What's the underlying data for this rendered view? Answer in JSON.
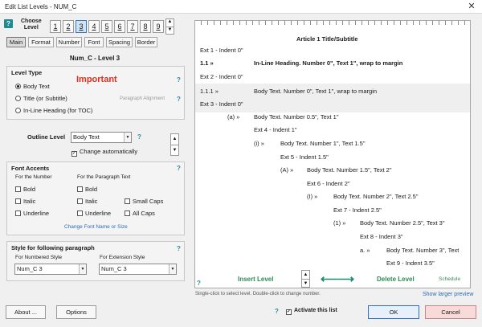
{
  "window": {
    "title": "Edit List Levels - NUM_C",
    "close": "✕"
  },
  "help": "?",
  "choose_level": {
    "label_line1": "Choose",
    "label_line2": "Level",
    "levels": [
      "1",
      "2",
      "3",
      "4",
      "5",
      "6",
      "7",
      "8",
      "9"
    ],
    "selected": "3"
  },
  "tabs": [
    "Main",
    "Format",
    "Number",
    "Font",
    "Spacing",
    "Border"
  ],
  "level_heading": "Num_C - Level 3",
  "level_type": {
    "title": "Level Type",
    "important": "Important",
    "options": [
      "Body Text",
      "Title (or Subtitle)",
      "In-Line Heading (for TOC)"
    ],
    "selected": "Body Text",
    "paragraph_alignment": "Paragraph Alignment"
  },
  "outline_level": {
    "label": "Outline Level",
    "value": "Body Text",
    "change_auto": "Change automatically"
  },
  "font_accents": {
    "title": "Font Accents",
    "for_number": "For the Number",
    "for_paragraph": "For the Paragraph Text",
    "bold": "Bold",
    "italic": "Italic",
    "underline": "Underline",
    "small_caps": "Small Caps",
    "all_caps": "All Caps",
    "change_font": "Change Font Name or Size"
  },
  "style_following": {
    "title": "Style for following paragraph",
    "numbered_label": "For Numbered Style",
    "numbered_value": "Num_C 3",
    "extension_label": "For Extension Style",
    "extension_value": "Num_C 3"
  },
  "buttons": {
    "about": "About ...",
    "options": "Options",
    "ok": "OK",
    "cancel": "Cancel"
  },
  "activate": "Activate this list",
  "preview": {
    "title": "Article 1 Title/Subtitle",
    "rows": [
      "Ext 1 - Indent 0\"",
      "1.1 »",
      "In-Line Heading.  Number 0\", Text 1\", wrap to margin",
      "Ext 2 - Indent 0\"",
      "1.1.1 »",
      "Body Text.  Number 0\", Text 1\", wrap to margin",
      "Ext 3 - Indent 0\"",
      "(a) »",
      "Body Text.  Number 0.5\", Text 1\"",
      "Ext 4 - Indent 1\"",
      "(i) »",
      "Body Text.  Number 1\", Text 1.5\"",
      "Ext 5 - Indent 1.5\"",
      "(A) »",
      "Body Text.  Number 1.5\", Text 2\"",
      "Ext 6 - Indent 2\"",
      "(I) »",
      "Body Text.  Number 2\", Text 2.5\"",
      "Ext 7 - Indent 2.5\"",
      "(1) »",
      "Body Text.  Number 2.5\", Text 3\"",
      "Ext 8 - Indent 3\"",
      "a. »",
      "Body Text.  Number 3\", Text",
      "Ext 9 - Indent 3.5\""
    ],
    "insert_level": "Insert Level",
    "delete_level": "Delete Level",
    "schedule": "Schedule",
    "hint": "Single-click to select level.  Double-click to change number.",
    "show_larger": "Show larger preview"
  },
  "colors": {
    "accent": "#2e8b9a",
    "important": "#e0301e",
    "preview_action": "#2e8b57"
  }
}
